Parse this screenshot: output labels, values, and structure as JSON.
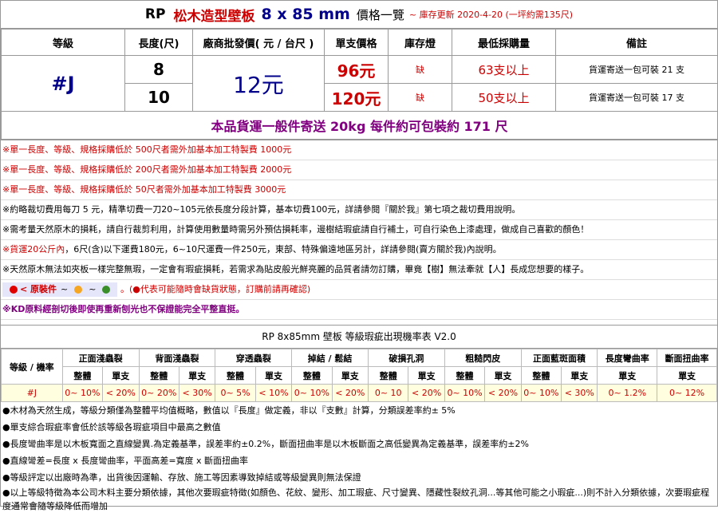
{
  "title": {
    "rp": "RP",
    "name": "松木造型壁板",
    "size": "8 x 85 mm",
    "list": "價格一覽",
    "note": "~ 庫存更新 2020-4-20 (一坪約需135尺)"
  },
  "price_table": {
    "headers": [
      "等級",
      "長度(尺)",
      "廠商批發價( 元 / 台尺 )",
      "單支價格",
      "庫存燈",
      "最低採購量",
      "備註"
    ],
    "grade": "#J",
    "wholesale": "12元",
    "rows": [
      {
        "length": "8",
        "unit_price": "96元",
        "stock": "缺",
        "min_qty": "63支以上",
        "remark": "貨運寄送一包可裝 21 支"
      },
      {
        "length": "10",
        "unit_price": "120元",
        "stock": "缺",
        "min_qty": "50支以上",
        "remark": "貨運寄送一包可裝 17 支"
      }
    ],
    "shipping": "本品貨運一般件寄送 20kg 每件約可包裝約 171 尺"
  },
  "notes": [
    {
      "text": "※單一長度、等級、規格採購低於 500尺者需外加基本加工特製費 1000元",
      "color": "red"
    },
    {
      "text": "※單一長度、等級、規格採購低於 200尺者需外加基本加工特製費  2000元",
      "color": "red"
    },
    {
      "text": "※單一長度、等級、規格採購低於  50尺者需外加基本加工特製費  3000元",
      "color": "red"
    },
    {
      "text": "※約略裁切費用每刀 5 元，精準切費一刀20~105元依長度分段計算，基本切費100元，詳請參閱『關於我』第七項之裁切費用說明。",
      "color": "black"
    },
    {
      "text": "※需考量天然原木的損耗，請自行裁剪利用，計算使用數量時需另外預估損耗率，邊樹結瑕疵請自行補土，可自行染色上漆處理，做成自己喜歡的顏色！",
      "color": "black"
    },
    {
      "text_red": "※貨運20公斤內",
      "text": "，6尺(含)以下運費180元，6~10尺運費一件250元，東部、特殊偏遠地區另計，詳請參閱(賣方關於我)內說明。",
      "color": "mixed"
    },
    {
      "text": "※天然原木無法如夾板一樣完整無瑕，一定會有瑕疵損耗，若需求為貼皮般光鮮亮麗的品質者請勿訂購，畢竟【樹】無法牽就【人】長成您想要的樣子。",
      "color": "black"
    }
  ],
  "legend": {
    "label": "< 原裝件",
    "tilde": "~",
    "note": "。(●代表可能隨時會缺貨狀態，訂購前請再確認)",
    "colors": {
      "red": "#e00000",
      "orange": "#f5a623",
      "green": "#3a8f2a"
    }
  },
  "kd_note": "※KD原料經剖切後即使再重新刨光也不保證能完全平整直挺。",
  "defect": {
    "title": "RP 8x85mm 壁板 等級瑕疵出現機率表 V2.0",
    "grade_header": "等級 / 機率",
    "groups": [
      "正面淺蟲裂",
      "背面淺蟲裂",
      "穿透蟲裂",
      "掉結 / 鬆結",
      "破損孔洞",
      "粗糙閃皮",
      "正面藍斑面積",
      "長度彎曲率",
      "斷面扭曲率"
    ],
    "sub_whole": "整體",
    "sub_single": "單支",
    "grade": "#J",
    "values": [
      "0~ 10%",
      "< 20%",
      "0~ 20%",
      "< 30%",
      "0~ 5%",
      "< 10%",
      "0~ 10%",
      "< 20%",
      "0~ 10",
      "< 20%",
      "0~ 10%",
      "< 20%",
      "0~ 10%",
      "< 30%",
      "0~ 1.2%",
      "0~ 12%"
    ]
  },
  "footnotes": [
    "●木材為天然生成，等級分類僅為整體平均值概略，數值以『長度』做定義，非以『支數』計算，分類誤差率約± 5%",
    "●單支綜合瑕疵率會低於該等級各瑕疵項目中最高之數值",
    "●長度彎曲率是以木板寬面之直線變異.為定義基準，誤差率約±0.2%，斷面扭曲率是以木板斷面之高低變異為定義基準，誤差率約±2%",
    "●直線彎差=長度 x 長度彎曲率，平面高差=寬度 x 斷面扭曲率",
    "●等級評定以出廠時為準，出貨後因運輸、存放、施工等因素導致掉結或等級變異則無法保證",
    "●以上等級特徵為本公司木料主要分類依據，其他次要瑕疵特徵(如顏色、花紋、變形、加工瑕疵、尺寸變異、隱藏性裂紋孔洞...等其他可能之小瑕疵...)則不計入分類依據，次要瑕疵程度通常會隨等級降低而增加"
  ]
}
